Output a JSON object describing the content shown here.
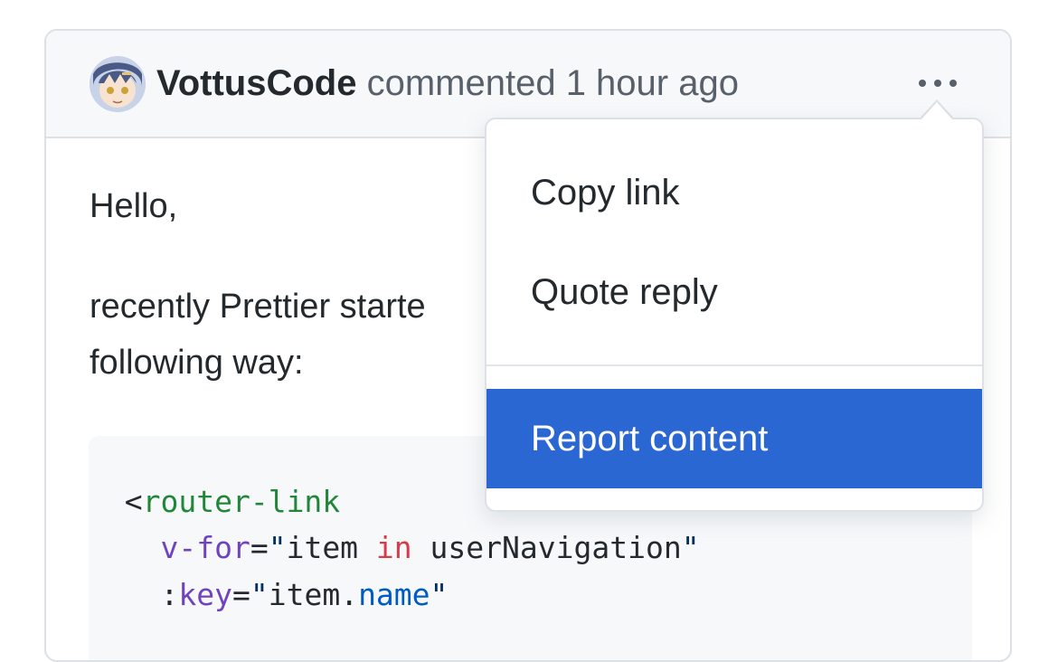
{
  "comment": {
    "author": "VottusCode",
    "meta": "commented 1 hour ago",
    "avatar_alt": "VottusCode avatar",
    "more_actions_icon": "kebab-horizontal-icon",
    "body": {
      "greeting": "Hello,",
      "line1": "recently Prettier starte",
      "line2": "following way:"
    },
    "code": {
      "line1": {
        "indent": "  ",
        "open": "<",
        "tag": "router-link"
      },
      "line2": {
        "indent": "    ",
        "attr": "v-for",
        "eq": "=",
        "q1": "\"",
        "s1": "item ",
        "kw": "in",
        "s2": " userNavigation",
        "q2": "\""
      },
      "line3": {
        "indent": "    ",
        "colon": ":",
        "attr": "key",
        "eq": "=",
        "q1": "\"",
        "s1": "item.",
        "prop": "name",
        "q2": "\""
      }
    }
  },
  "dropdown": {
    "items": [
      {
        "label": "Copy link"
      },
      {
        "label": "Quote reply"
      },
      {
        "label": "Report content",
        "active": true
      }
    ]
  },
  "colors": {
    "accent": "#2b67d3",
    "header_bg": "#f6f8fa",
    "border": "#dde1e5",
    "text": "#24292e",
    "muted": "#586069"
  }
}
